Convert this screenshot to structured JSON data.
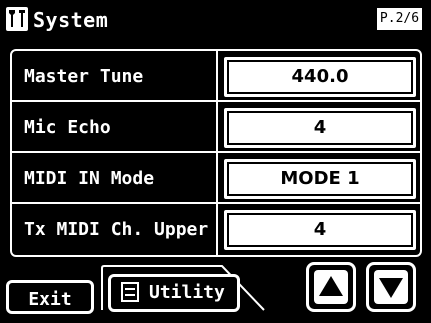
{
  "header": {
    "title": "System",
    "page": "P.2/6",
    "icon": "tools-icon"
  },
  "params": [
    {
      "label": "Master Tune",
      "value": "440.0"
    },
    {
      "label": "Mic Echo",
      "value": "4"
    },
    {
      "label": "MIDI IN Mode",
      "value": "MODE 1"
    },
    {
      "label": "Tx MIDI Ch. Upper",
      "value": "4"
    }
  ],
  "footer": {
    "exit_label": "Exit",
    "utility_label": "Utility",
    "up_icon": "up-arrow-icon",
    "down_icon": "down-arrow-icon"
  },
  "colors": {
    "background": "#000000",
    "foreground": "#ffffff"
  }
}
